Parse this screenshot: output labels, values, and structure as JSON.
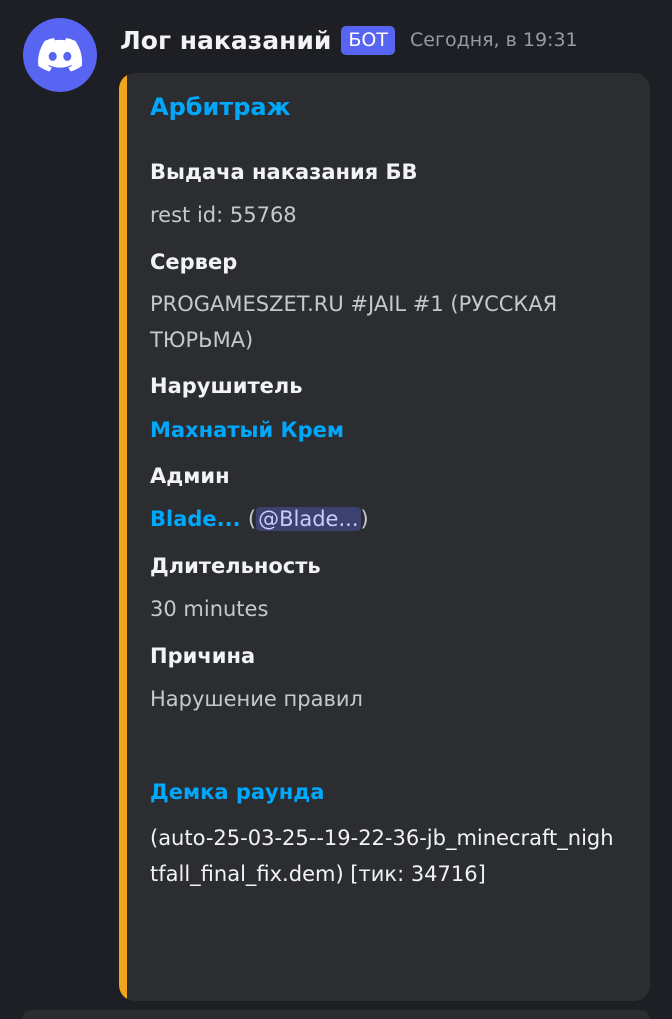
{
  "message": {
    "author": "Лог наказаний",
    "bot_tag": "БОТ",
    "timestamp": "Сегодня, в 19:31",
    "avatar_icon": "discord-logo-icon"
  },
  "embed": {
    "accent_color": "#f0a51c",
    "title": "Арбитраж",
    "fields": {
      "punishment": {
        "name": "Выдача наказания БВ",
        "value": "rest id: 55768"
      },
      "server": {
        "name": "Сервер",
        "value": "PROGAMESZET.RU #JAIL #1 (РУССКАЯ ТЮРЬМА)"
      },
      "offender": {
        "name": "Нарушитель",
        "value": "Махнатый Крем"
      },
      "admin": {
        "name": "Админ",
        "value": "Blade...",
        "open_paren": "(",
        "mention": "@Blade...",
        "close_paren": ")"
      },
      "duration": {
        "name": "Длительность",
        "value": "30 minutes"
      },
      "reason": {
        "name": "Причина",
        "value": "Нарушение правил"
      }
    },
    "demo": {
      "link": "Демка раунда",
      "value": "(auto-25-03-25--19-22-36-jb_minecraft_nightfall_final_fix.dem) [тик: 34716]"
    }
  },
  "colors": {
    "background": "#1e1f24",
    "embed_background": "#2b2d31",
    "link": "#00a8fc",
    "bot_tag": "#5865f2"
  }
}
